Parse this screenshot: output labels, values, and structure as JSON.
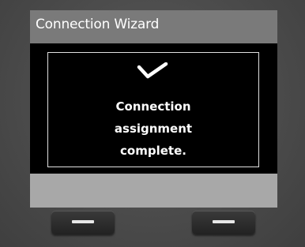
{
  "title_bar": {
    "title": "Connection Wizard"
  },
  "message": {
    "icon": "checkmark-icon",
    "line1": "Connection",
    "line2": "assignment",
    "line3": "complete."
  },
  "softkeys": {
    "left_icon": "dash-icon",
    "right_icon": "dash-icon"
  },
  "colors": {
    "title_bar_bg": "#7a7a7a",
    "content_bg": "#000000",
    "text": "#ffffff"
  }
}
